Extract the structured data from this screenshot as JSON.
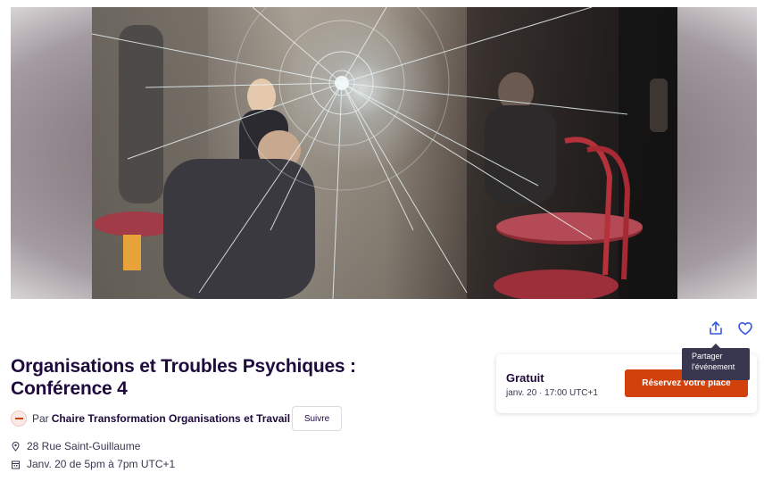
{
  "hero": {
    "image_alt": "Vitrine brisée devant une terrasse de café"
  },
  "actions": {
    "share_tooltip_line1": "Partager",
    "share_tooltip_line2": "l'événement"
  },
  "event": {
    "title": "Organisations et Troubles Psychiques : Conférence 4",
    "organizer_prefix": "Par",
    "organizer_name": "Chaire Transformation Organisations et Travail",
    "follow_label": "Suivre",
    "location": "28 Rue Saint-Guillaume",
    "date": "Janv. 20 de 5pm à 7pm UTC+1"
  },
  "ticket": {
    "price": "Gratuit",
    "when": "janv. 20 · 17:00 UTC+1",
    "reserve_label": "Réservez votre place"
  },
  "colors": {
    "accent": "#d1410c",
    "text": "#1e0a3c",
    "tooltip_bg": "#39364f"
  },
  "icons": [
    "share-icon",
    "heart-icon",
    "location-pin-icon",
    "calendar-icon"
  ]
}
